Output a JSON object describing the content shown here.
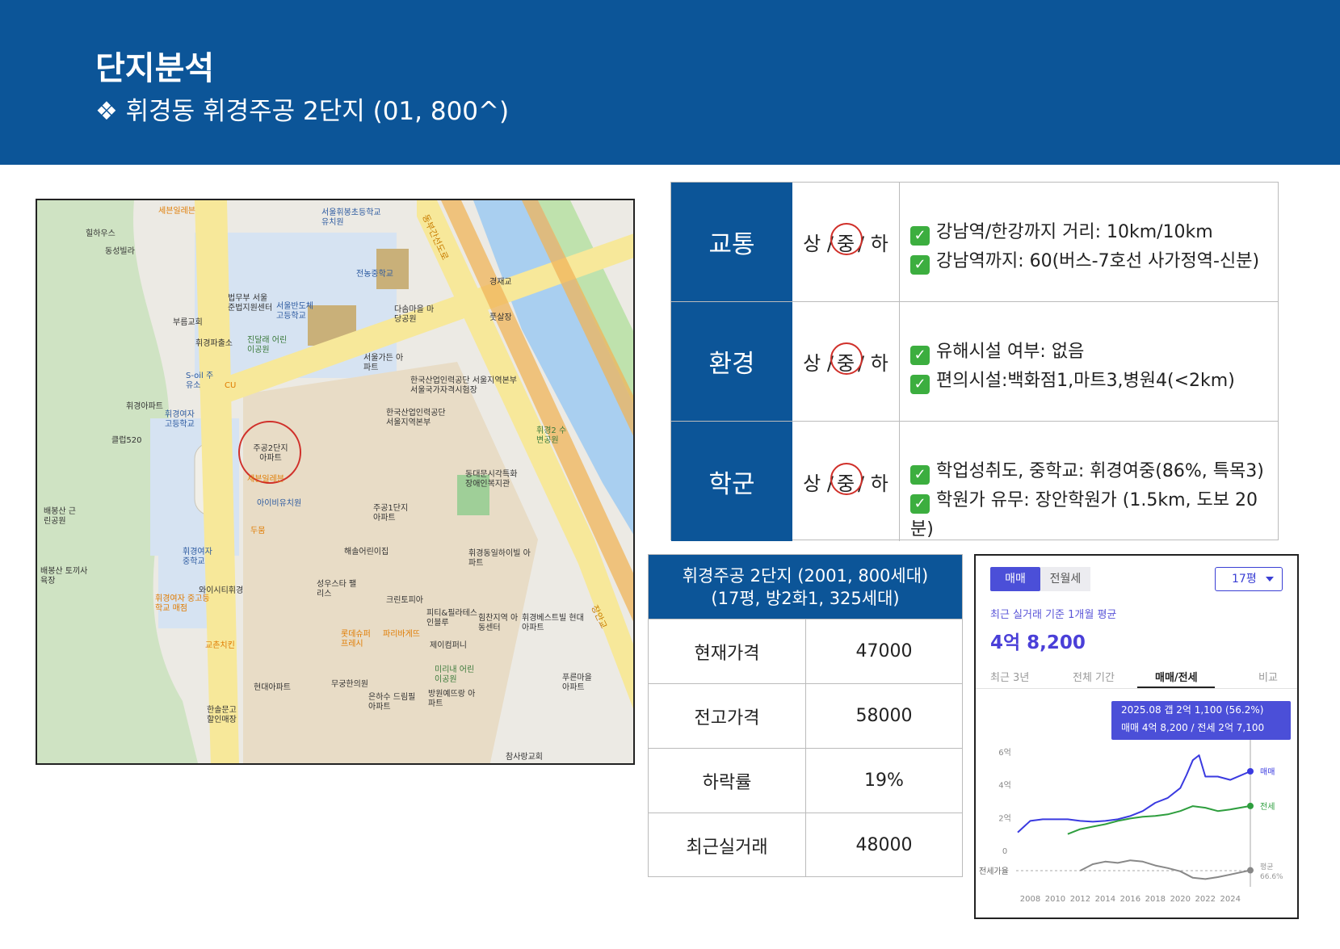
{
  "header": {
    "title": "단지분석",
    "subtitle": "❖ 휘경동 휘경주공 2단지 (01, 800^)"
  },
  "map": {
    "labels": {
      "l1": "세븐일레븐",
      "l2": "서울휘봉초등학교 유치원",
      "l3": "힐하우스",
      "l4": "동성빌라",
      "l5": "전농중학교",
      "l6": "법무부 서울 준법지원센터",
      "l7": "서울반도체 고등학교",
      "l8": "다솜마을 마당공원",
      "l9": "부름교회",
      "l10": "휘경파출소",
      "l11": "진달래 어린이공원",
      "l12": "서울가든 아파트",
      "l13": "S-oil 주유소",
      "l14": "CU",
      "l15": "한국산업인력공단 서울지역본부 서울국가자격시험장",
      "l16": "휘경아파트",
      "l17": "휘경여자 고등학교",
      "l18": "한국산업인력공단 서울지역본부",
      "l19": "클럽520",
      "l20": "주공2단지 아파트",
      "l21": "세븐일레븐",
      "l22": "휘경2 수변공원",
      "l23": "동대문시각특화 장애인복지관",
      "l24": "배봉산 근린공원",
      "l25": "아이비유치원",
      "l26": "두뭄",
      "l27": "주공1단지 아파트",
      "l28": "휘경여자 중학교",
      "l29": "해솔어린이집",
      "l30": "휘경동일하이빌 아파트",
      "l31": "배봉산 토끼사육장",
      "l32": "와이시티휘경",
      "l33": "휘경여자 중고등학교 매점",
      "l34": "성우스타 팰리스",
      "l35": "크린토피아",
      "l36": "피티&필라테스 인블루",
      "l37": "힘찬지역 아동센터",
      "l38": "휘경베스트빌 현대아파트",
      "l39": "교촌치킨",
      "l40": "롯데슈퍼 프레시",
      "l41": "파리바게뜨",
      "l42": "제이컴퍼니",
      "l43": "미리내 어린이공원",
      "l44": "무궁한의원",
      "l45": "현대아파트",
      "l46": "은하수 드림필아파트",
      "l47": "방원예뜨랑 아파트",
      "l48": "푸른마을 아파트",
      "l49": "한솔문고 할인매장",
      "l50": "참사랑교회",
      "l51": "풋살장",
      "l52": "경재교",
      "l53": "동부간선도로",
      "l54": "장안교"
    }
  },
  "criteria": [
    {
      "category": "교통",
      "rating_left": "상 /",
      "rating_mid": "중",
      "rating_right": "/ 하",
      "details": [
        "강남역/한강까지 거리: 10km/10km",
        "강남역까지: 60(버스-7호선 사가정역-신분)"
      ]
    },
    {
      "category": "환경",
      "rating_left": "상 /",
      "rating_mid": "중",
      "rating_right": "/ 하",
      "details": [
        "유해시설 여부: 없음",
        "편의시설:백화점1,마트3,병원4(<2km)"
      ]
    },
    {
      "category": "학군",
      "rating_left": "상 /",
      "rating_mid": "중",
      "rating_right": "/ 하",
      "details": [
        "학업성취도, 중학교: 휘경여중(86%, 특목3)",
        "학원가 유무: 장안학원가 (1.5km, 도보 20분)"
      ]
    }
  ],
  "price_table": {
    "header_line1": "휘경주공 2단지 (2001, 800세대)",
    "header_line2": "(17평, 방2화1, 325세대)",
    "rows": [
      {
        "label": "현재가격",
        "value": "47000"
      },
      {
        "label": "전고가격",
        "value": "58000"
      },
      {
        "label": "하락률",
        "value": "19%"
      },
      {
        "label": "최근실거래",
        "value": "48000"
      }
    ]
  },
  "chart_panel": {
    "tab_sale": "매매",
    "tab_rent": "전월세",
    "size_select": "17평",
    "caption": "최근 실거래 기준 1개월 평균",
    "big_price": "4억 8,200",
    "period_tabs": [
      "최근 3년",
      "전체 기간",
      "매매/전세",
      "비교"
    ],
    "active_period_tab": 2,
    "tooltip_line1": "2025.08  갭 2억 1,100 (56.2%)",
    "tooltip_line2": "매매 4억 8,200 / 전세 2억 7,100",
    "colors": {
      "accent": "#4b4fd8",
      "sale": "#3a3ae0",
      "jeonse": "#2e9e3e",
      "ratio": "#888888"
    }
  },
  "chart_data": {
    "type": "line",
    "y_ticks": [
      "6억",
      "4억",
      "2억",
      "0"
    ],
    "ratio_label": "전세가율",
    "ratio_end_label_1": "평균",
    "ratio_end_label_2": "66.6%",
    "x_ticks": [
      "2008",
      "2010",
      "2012",
      "2014",
      "2016",
      "2018",
      "2020",
      "2022",
      "2024"
    ],
    "ylim": [
      0,
      7
    ],
    "series": [
      {
        "name": "매매",
        "x": [
          2007,
          2008,
          2009,
          2010,
          2011,
          2012,
          2013,
          2014,
          2015,
          2016,
          2017,
          2018,
          2019,
          2020,
          2020.5,
          2021,
          2021.5,
          2022,
          2022.5,
          2023,
          2024,
          2025.6
        ],
        "values": [
          1.1,
          1.8,
          1.9,
          1.9,
          1.9,
          1.8,
          1.75,
          1.8,
          1.9,
          2.1,
          2.4,
          2.9,
          3.2,
          3.8,
          4.6,
          5.5,
          5.8,
          4.5,
          4.5,
          4.5,
          4.3,
          4.82
        ]
      },
      {
        "name": "전세",
        "x": [
          2011,
          2012,
          2013,
          2014,
          2015,
          2016,
          2017,
          2018,
          2019,
          2020,
          2021,
          2022,
          2023,
          2024,
          2025.6
        ],
        "values": [
          1.0,
          1.3,
          1.45,
          1.6,
          1.8,
          1.95,
          2.05,
          2.1,
          2.2,
          2.4,
          2.7,
          2.6,
          2.4,
          2.5,
          2.71
        ]
      },
      {
        "name": "전세가율",
        "x": [
          2007,
          2008,
          2009,
          2010,
          2011,
          2012,
          2013,
          2014,
          2015,
          2016,
          2017,
          2018,
          2019,
          2020,
          2021,
          2022,
          2023,
          2024,
          2025.6
        ],
        "values": [
          null,
          null,
          null,
          null,
          null,
          66,
          76,
          80,
          78,
          82,
          80,
          74,
          70,
          65,
          55,
          53,
          56,
          60,
          66.6
        ]
      }
    ]
  }
}
